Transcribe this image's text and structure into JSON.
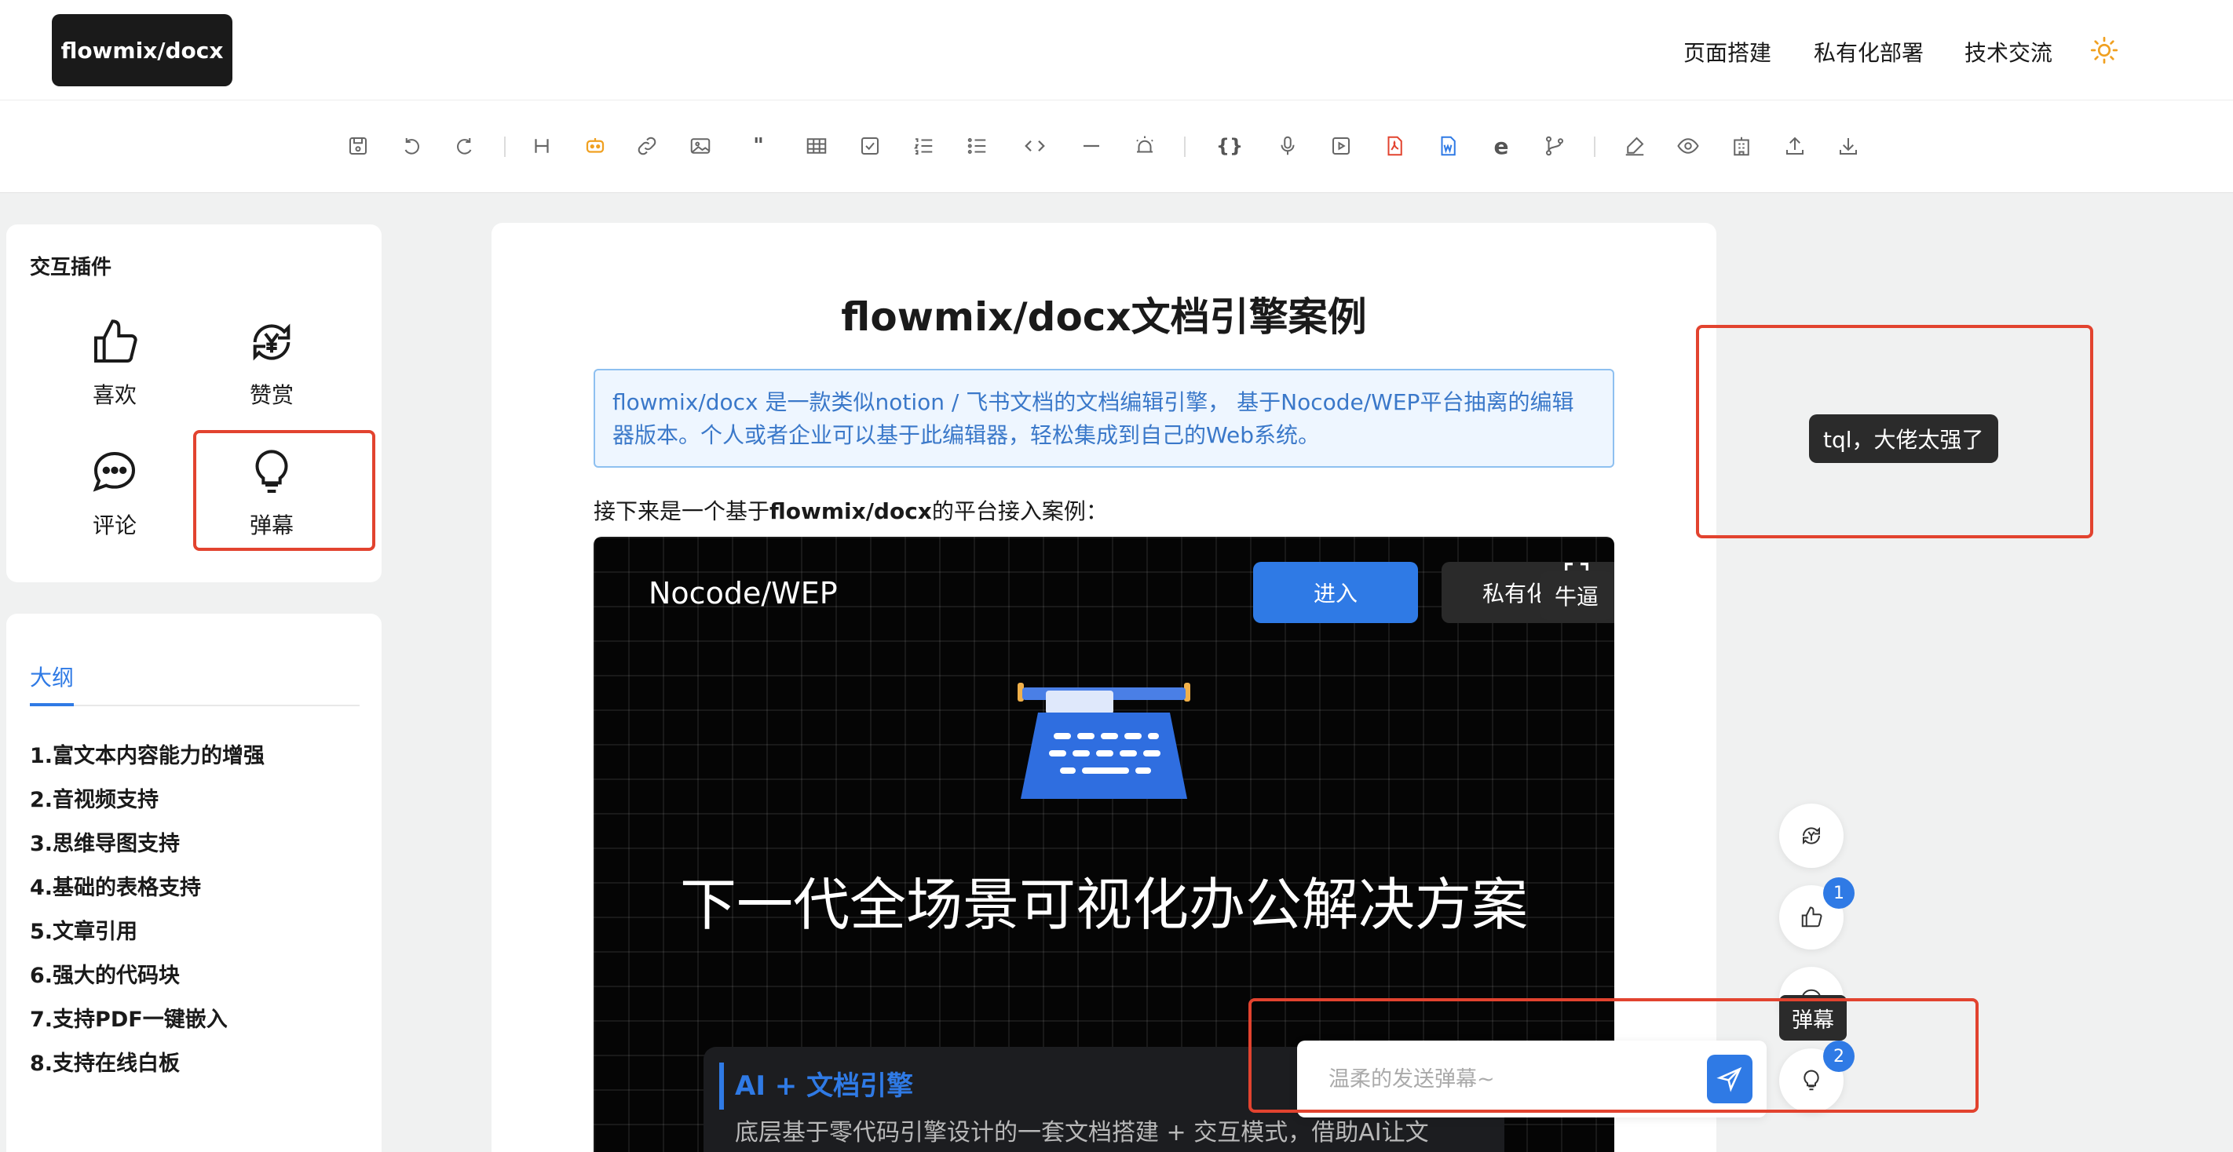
{
  "header": {
    "logo": "flowmix/docx",
    "nav": [
      "页面搭建",
      "私有化部署",
      "技术交流"
    ],
    "theme_icon": "sun-icon"
  },
  "toolbar": {
    "icons": [
      "save-icon",
      "undo-icon",
      "redo-icon",
      "heading-icon",
      "ai-robot-icon",
      "link-icon",
      "image-icon",
      "quote-icon",
      "table-icon",
      "checkbox-icon",
      "ordered-list-icon",
      "bullet-list-icon",
      "code-icon",
      "divider-icon",
      "alert-icon",
      "code-block-icon",
      "audio-icon",
      "video-icon",
      "pdf-icon",
      "word-icon",
      "web-embed-icon",
      "git-branch-icon",
      "sign-icon",
      "preview-icon",
      "building-icon",
      "upload-icon",
      "download-icon"
    ],
    "ai_color": "#f0a020",
    "pdf_color": "#e2432f",
    "word_color": "#2f7ae5"
  },
  "plugins": {
    "title": "交互插件",
    "items": [
      {
        "label": "喜欢",
        "icon": "thumbs-up-icon"
      },
      {
        "label": "赞赏",
        "icon": "yen-reward-icon"
      },
      {
        "label": "评论",
        "icon": "comment-icon"
      },
      {
        "label": "弹幕",
        "icon": "lightbulb-icon"
      }
    ]
  },
  "outline": {
    "tab": "大纲",
    "items": [
      "1.富文本内容能力的增强",
      "2.音视频支持",
      "3.思维导图支持",
      "4.基础的表格支持",
      "5.文章引用",
      "6.强大的代码块",
      "7.支持PDF一键嵌入",
      "8.支持在线白板"
    ]
  },
  "doc": {
    "title": "flowmix/docx文档引擎案例",
    "callout": "flowmix/docx 是一款类似notion / 飞书文档的文档编辑引擎， 基于Nocode/WEP平台抽离的编辑器版本。个人或者企业可以基于此编辑器，轻松集成到自己的Web系统。",
    "para_prefix": "接下来是一个基于",
    "para_bold": "flowmix/docx",
    "para_suffix": "的平台接入案例："
  },
  "embed": {
    "brand": "Nocode/WEP",
    "enter": "进入",
    "private": "私有化部署",
    "headline": "下一代全场景可视化办公解决方案",
    "card_title": "AI + 文档引擎",
    "card_text": "底层基于零代码引擎设计的一套文档搭建 + 交互模式，借助AI让文"
  },
  "danmaku": {
    "top": "tql，大佬太强了",
    "middle": "牛逼"
  },
  "fabs": {
    "reward_badge": "",
    "like_badge": "1",
    "danmaku_badge": "2",
    "tooltip": "弹幕"
  },
  "send": {
    "placeholder": "温柔的发送弹幕~"
  },
  "accent": "#2f7ae5",
  "highlight": "#e2432f"
}
